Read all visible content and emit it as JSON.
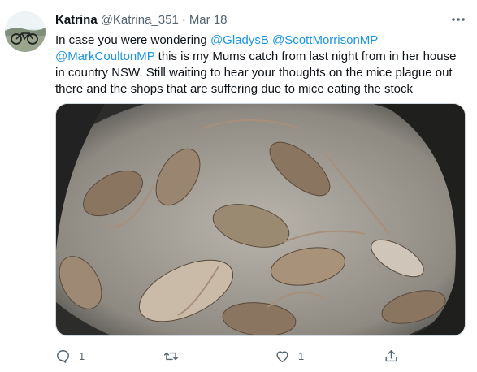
{
  "tweet": {
    "author_name": "Katrina",
    "author_handle": "@Katrina_351",
    "separator": "·",
    "date": "Mar 18",
    "text_segments": {
      "intro": "In case you were wondering ",
      "mention_1": "@GladysB",
      "space_1": " ",
      "mention_2": "@ScottMorrisonMP",
      "space_2": " ",
      "mention_3": "@MarkCoultonMP",
      "body": " this is my Mums catch from last night from in her house in country NSW. Still waiting to hear your thoughts on the mice plague out there and the shops that are suffering due to mice eating the stock"
    }
  },
  "actions": {
    "reply_count": "1",
    "retweet_count": "",
    "like_count": "1"
  },
  "colors": {
    "link": "#1b95e0",
    "secondary_text": "#536471",
    "primary_text": "#0f1419",
    "border": "#cfd9de"
  },
  "icons": {
    "more": "more-dots-icon",
    "reply": "reply-icon",
    "retweet": "retweet-icon",
    "like": "like-icon",
    "share": "share-icon"
  }
}
